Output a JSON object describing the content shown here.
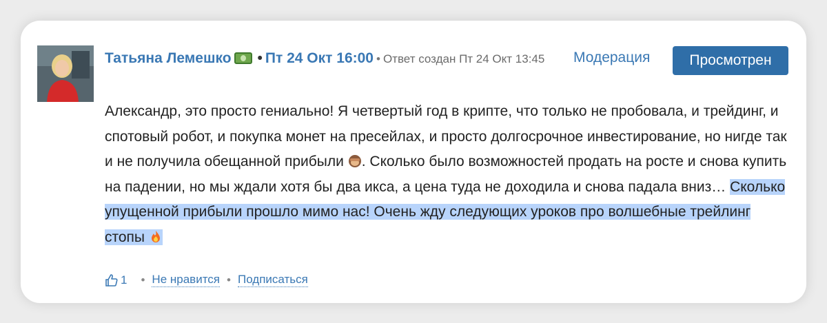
{
  "comment": {
    "author": "Татьяна Лемешко",
    "author_badge_icon": "money-icon",
    "datetime": "Пт 24 Окт 16:00",
    "created_text": "Ответ создан Пт 24 Окт 13:45",
    "moderation_label": "Модерация",
    "viewed_label": "Просмотрен",
    "body_plain": "Александр, это просто гениально! Я четвертый год в крипте, что только не пробовала, и трейдинг, и спотовый робот, и покупка монет на пресейлах, и просто долгосрочное инвестирование, но нигде так и не получила обещанной прибыли",
    "body_emoji_1": "see-no-evil-monkey-icon",
    "body_plain_2": ". Сколько было возможностей продать на росте и снова купить на падении, но мы ждали хотя бы два икса, а цена туда не доходила и снова падала вниз…",
    "body_highlighted": "Сколько упущенной прибыли прошло мимо нас! Очень жду следующих уроков про волшебные трейлинг стопы",
    "body_emoji_2": "fire-icon",
    "highlight_color": "#b8d4fb"
  },
  "footer": {
    "like_icon": "thumbs-up-icon",
    "like_count": "1",
    "dislike_label": "Не нравится",
    "subscribe_label": "Подписаться"
  },
  "colors": {
    "accent": "#3a78b4",
    "button_bg": "#2f6ea8"
  }
}
